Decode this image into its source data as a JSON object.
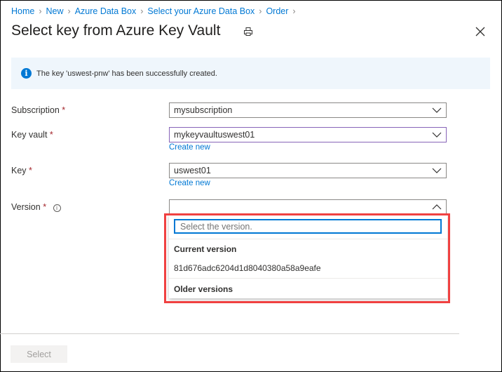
{
  "breadcrumb": [
    "Home",
    "New",
    "Azure Data Box",
    "Select your Azure Data Box",
    "Order"
  ],
  "title": "Select key from Azure Key Vault",
  "banner": {
    "message": "The key 'uswest-pnw' has been successfully created."
  },
  "form": {
    "subscription": {
      "label": "Subscription",
      "required": "*",
      "value": "mysubscription"
    },
    "key_vault": {
      "label": "Key vault",
      "required": "*",
      "value": "mykeyvaultuswest01",
      "create_new": "Create new"
    },
    "key": {
      "label": "Key",
      "required": "*",
      "value": "uswest01",
      "create_new": "Create new"
    },
    "version": {
      "label": "Version",
      "required": "*",
      "value": ""
    }
  },
  "dropdown": {
    "placeholder": "Select the version.",
    "current_header": "Current version",
    "current_item": "81d676adc6204d1d8040380a58a9eafe",
    "older_header": "Older versions"
  },
  "footer": {
    "select_label": "Select"
  }
}
